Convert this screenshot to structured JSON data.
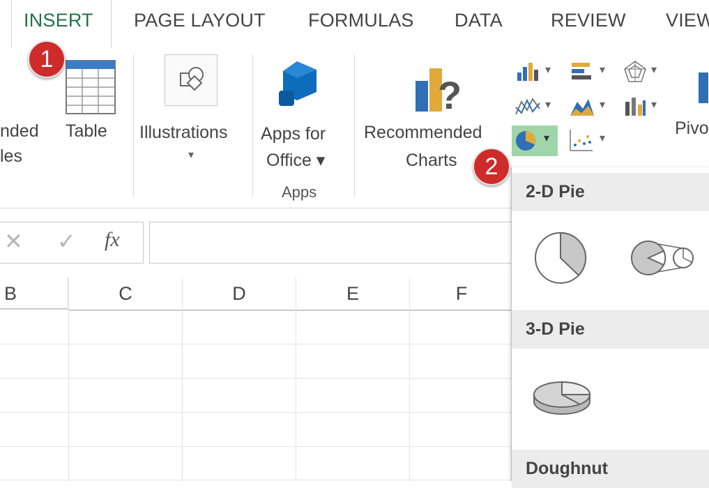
{
  "tabs": [
    {
      "label": "INSERT",
      "active": true
    },
    {
      "label": "PAGE LAYOUT"
    },
    {
      "label": "FORMULAS"
    },
    {
      "label": "DATA"
    },
    {
      "label": "REVIEW"
    },
    {
      "label": "VIEW"
    }
  ],
  "ribbon": {
    "recommended_tables": {
      "line1": "nded",
      "line2": "les"
    },
    "table": {
      "label": "Table"
    },
    "illustrations": {
      "label": "Illustrations",
      "arrow": "▾"
    },
    "apps_for_office": {
      "line1": "Apps for",
      "line2": "Office ▾"
    },
    "apps_group_label": "Apps",
    "recommended_charts": {
      "line1": "Recommended",
      "line2": "Charts"
    },
    "pivot": {
      "label": "Pivo"
    },
    "chart_arrow": "▾"
  },
  "badges": {
    "step1": "1",
    "step2": "2"
  },
  "formula_bar": {
    "cancel": "✕",
    "enter": "✓",
    "fx": "fx",
    "value": ""
  },
  "columns": [
    "B",
    "C",
    "D",
    "E",
    "F"
  ],
  "pie_menu": {
    "section_2d": "2-D Pie",
    "section_3d": "3-D Pie",
    "section_doughnut": "Doughnut"
  },
  "colors": {
    "accent": "#217346",
    "badge": "#cf2b2b",
    "icon_blue": "#0f6cbd",
    "icon_gold": "#e0a93a"
  }
}
